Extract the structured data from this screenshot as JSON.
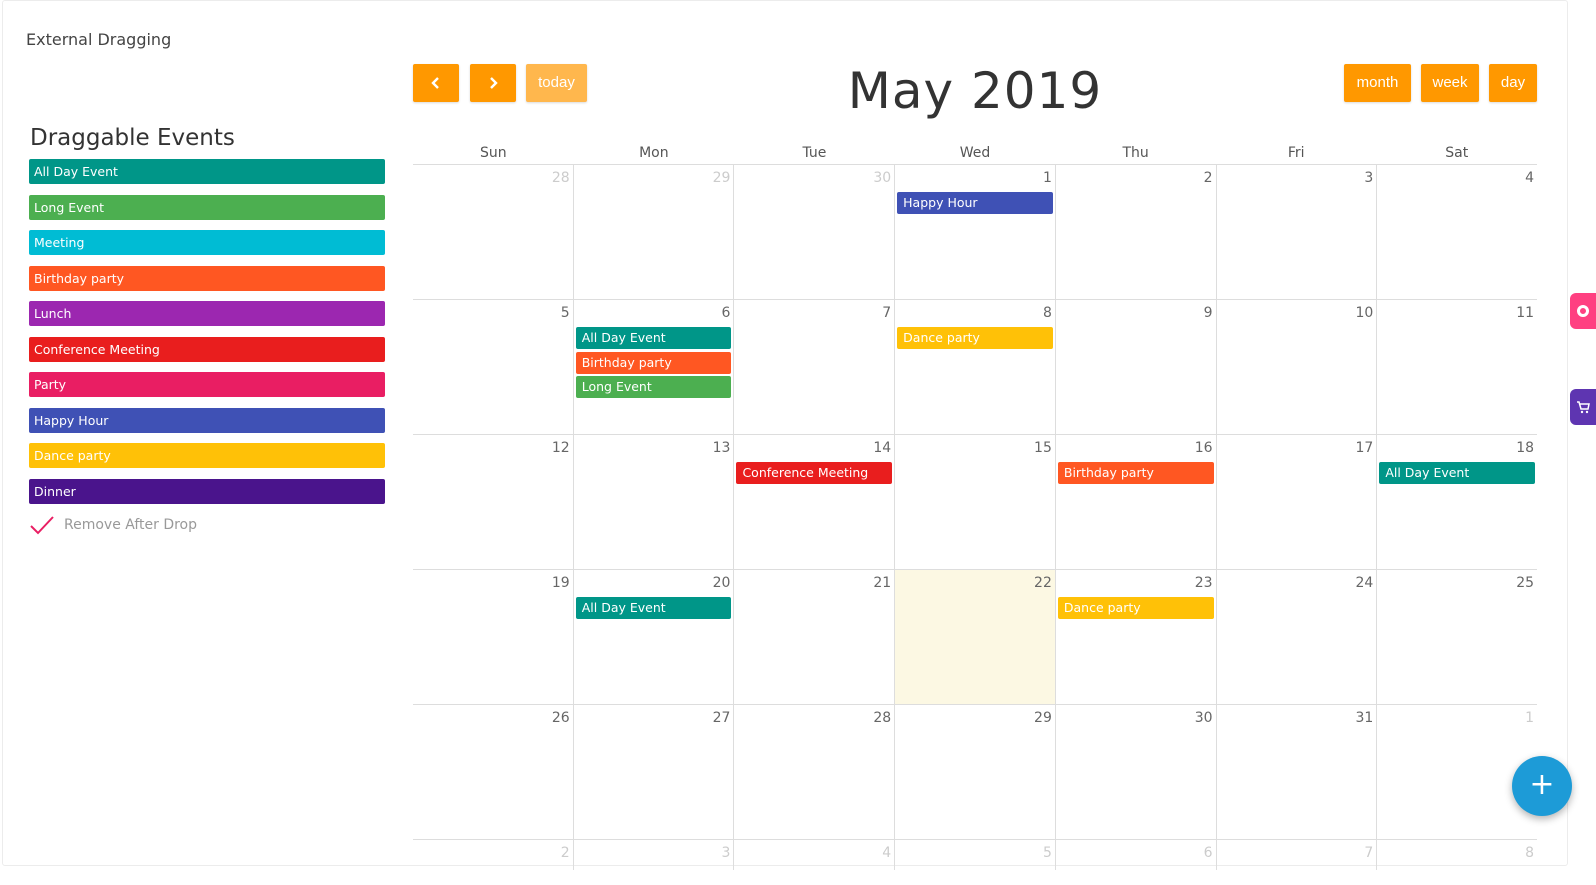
{
  "card": {
    "title": "External Dragging"
  },
  "sidebar": {
    "heading": "Draggable Events",
    "events": [
      {
        "label": "All Day Event",
        "color": "#009688"
      },
      {
        "label": "Long Event",
        "color": "#4caf50"
      },
      {
        "label": "Meeting",
        "color": "#00bcd4"
      },
      {
        "label": "Birthday party",
        "color": "#ff5722"
      },
      {
        "label": "Lunch",
        "color": "#9c27b0"
      },
      {
        "label": "Conference Meeting",
        "color": "#e91e1e"
      },
      {
        "label": "Party",
        "color": "#e91e63"
      },
      {
        "label": "Happy Hour",
        "color": "#3f51b5"
      },
      {
        "label": "Dance party",
        "color": "#ffc107"
      },
      {
        "label": "Dinner",
        "color": "#4a148c"
      }
    ],
    "remove_after_drop": {
      "label": "Remove After Drop",
      "checked": true
    }
  },
  "toolbar": {
    "prev_icon": "chevron-left-icon",
    "next_icon": "chevron-right-icon",
    "today_label": "today",
    "title": "May 2019",
    "views": [
      "month",
      "week",
      "day"
    ],
    "accent": "#ff9800"
  },
  "calendar": {
    "dow": [
      "Sun",
      "Mon",
      "Tue",
      "Wed",
      "Thu",
      "Fri",
      "Sat"
    ],
    "today_color": "#fcf8e3",
    "weeks": [
      [
        {
          "num": "28",
          "other": true,
          "events": []
        },
        {
          "num": "29",
          "other": true,
          "events": []
        },
        {
          "num": "30",
          "other": true,
          "events": []
        },
        {
          "num": "1",
          "events": [
            {
              "title": "Happy Hour",
              "color": "#3f51b5"
            }
          ]
        },
        {
          "num": "2",
          "events": []
        },
        {
          "num": "3",
          "events": []
        },
        {
          "num": "4",
          "events": []
        }
      ],
      [
        {
          "num": "5",
          "events": []
        },
        {
          "num": "6",
          "events": [
            {
              "title": "All Day Event",
              "color": "#009688"
            },
            {
              "title": "Birthday party",
              "color": "#ff5722"
            },
            {
              "title": "Long Event",
              "color": "#4caf50"
            }
          ]
        },
        {
          "num": "7",
          "events": []
        },
        {
          "num": "8",
          "events": [
            {
              "title": "Dance party",
              "color": "#ffc107"
            }
          ]
        },
        {
          "num": "9",
          "events": []
        },
        {
          "num": "10",
          "events": []
        },
        {
          "num": "11",
          "events": []
        }
      ],
      [
        {
          "num": "12",
          "events": []
        },
        {
          "num": "13",
          "events": []
        },
        {
          "num": "14",
          "events": [
            {
              "title": "Conference Meeting",
              "color": "#e91e1e"
            }
          ]
        },
        {
          "num": "15",
          "events": []
        },
        {
          "num": "16",
          "events": [
            {
              "title": "Birthday party",
              "color": "#ff5722"
            }
          ]
        },
        {
          "num": "17",
          "events": []
        },
        {
          "num": "18",
          "events": [
            {
              "title": "All Day Event",
              "color": "#009688"
            }
          ]
        }
      ],
      [
        {
          "num": "19",
          "events": []
        },
        {
          "num": "20",
          "events": [
            {
              "title": "All Day Event",
              "color": "#009688"
            }
          ]
        },
        {
          "num": "21",
          "events": []
        },
        {
          "num": "22",
          "today": true,
          "events": []
        },
        {
          "num": "23",
          "events": [
            {
              "title": "Dance party",
              "color": "#ffc107"
            }
          ]
        },
        {
          "num": "24",
          "events": []
        },
        {
          "num": "25",
          "events": []
        }
      ],
      [
        {
          "num": "26",
          "events": []
        },
        {
          "num": "27",
          "events": []
        },
        {
          "num": "28",
          "events": []
        },
        {
          "num": "29",
          "events": []
        },
        {
          "num": "30",
          "events": []
        },
        {
          "num": "31",
          "events": []
        },
        {
          "num": "1",
          "other": true,
          "events": []
        }
      ],
      [
        {
          "num": "2",
          "other": true,
          "events": []
        },
        {
          "num": "3",
          "other": true,
          "events": []
        },
        {
          "num": "4",
          "other": true,
          "events": []
        },
        {
          "num": "5",
          "other": true,
          "events": []
        },
        {
          "num": "6",
          "other": true,
          "events": []
        },
        {
          "num": "7",
          "other": true,
          "events": []
        },
        {
          "num": "8",
          "other": true,
          "events": []
        }
      ]
    ]
  },
  "floating": {
    "settings_icon": "gear-icon",
    "settings_color": "#ff4081",
    "cart_icon": "cart-icon",
    "cart_color": "#5e35b1",
    "fab_icon": "plus-icon",
    "fab_label": "+"
  }
}
